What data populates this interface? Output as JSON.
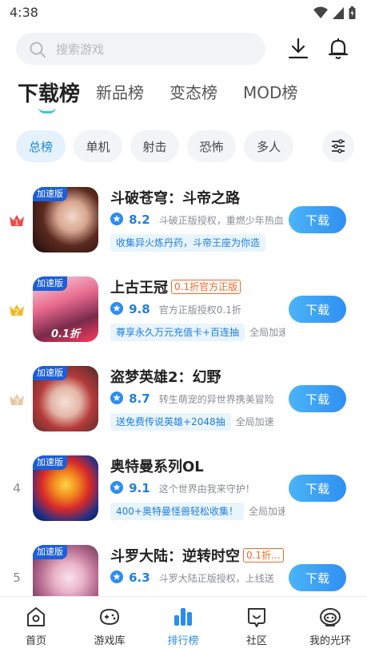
{
  "status_bar": {
    "time": "4:38"
  },
  "search": {
    "placeholder": "搜索游戏"
  },
  "tabs": [
    {
      "label": "下载榜"
    },
    {
      "label": "新品榜"
    },
    {
      "label": "变态榜"
    },
    {
      "label": "MOD榜"
    }
  ],
  "chips": [
    {
      "label": "总榜"
    },
    {
      "label": "单机"
    },
    {
      "label": "射击"
    },
    {
      "label": "恐怖"
    },
    {
      "label": "多人"
    }
  ],
  "games": [
    {
      "rank": "1",
      "badge": "加速版",
      "name": "斗破苍穹：斗帝之路",
      "tag": "",
      "score": "8.2",
      "desc": "斗破正版授权，重燃少年热血",
      "promo": "收集异火炼丹药，斗帝王座为你造",
      "promo_extra": "",
      "button": "下载",
      "icon_caption": ""
    },
    {
      "rank": "2",
      "badge": "加速版",
      "name": "上古王冠",
      "tag": "0.1折官方正版",
      "score": "9.8",
      "desc": "官方正版授权0.1折",
      "promo": "尊享永久万元充值卡+百连抽",
      "promo_extra": "全局加速",
      "button": "下载",
      "icon_caption": "0.1折"
    },
    {
      "rank": "3",
      "badge": "加速版",
      "name": "盗梦英雄2：幻野",
      "tag": "",
      "score": "8.7",
      "desc": "转生萌宠的异世界携美冒险",
      "promo": "送免费传说英雄+2048抽",
      "promo_extra": "全局加速",
      "button": "下载",
      "icon_caption": ""
    },
    {
      "rank": "4",
      "badge": "加速版",
      "name": "奥特曼系列OL",
      "tag": "",
      "score": "9.1",
      "desc": "这个世界由我来守护！",
      "promo": "400+奥特曼怪兽轻松收集！",
      "promo_extra": "全局加速",
      "button": "下载",
      "icon_caption": ""
    },
    {
      "rank": "5",
      "badge": "加速版",
      "name": "斗罗大陆：逆转时空",
      "tag": "0.1折...",
      "score": "6.3",
      "desc": "斗罗大陆正版授权，上线送",
      "promo": "",
      "promo_extra": "",
      "button": "下载",
      "icon_caption": ""
    }
  ],
  "nav": [
    {
      "label": "首页",
      "icon": "home-icon"
    },
    {
      "label": "游戏库",
      "icon": "gamepad-icon"
    },
    {
      "label": "排行榜",
      "icon": "ranking-icon"
    },
    {
      "label": "社区",
      "icon": "community-icon"
    },
    {
      "label": "我的光环",
      "icon": "profile-icon"
    }
  ],
  "colors": {
    "accent": "#2a8cf0",
    "tag": "#f06a2a",
    "badge": "#1c5fd8",
    "active_chip_bg": "#e5f2fd"
  }
}
